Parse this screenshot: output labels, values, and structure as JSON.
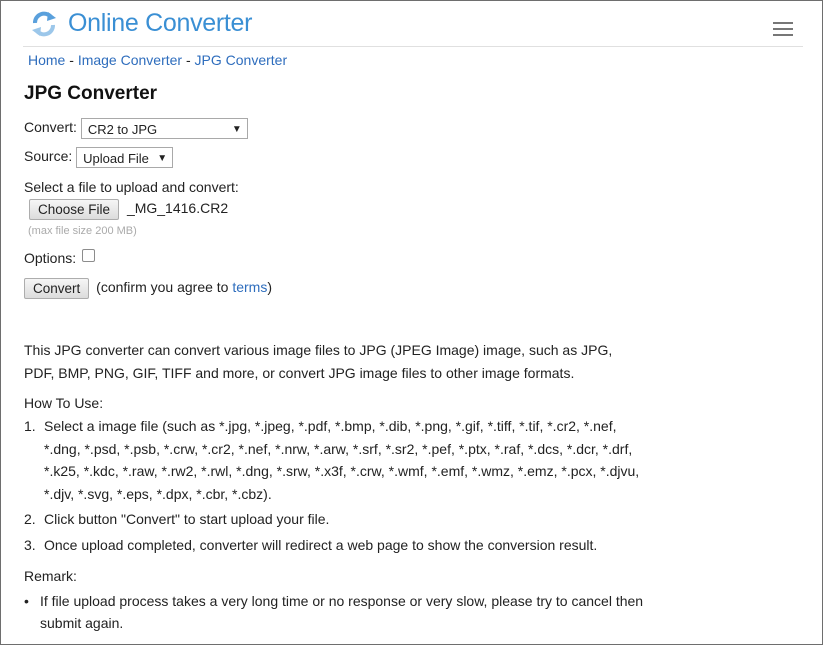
{
  "header": {
    "title": "Online Converter",
    "menu_icon": "hamburger-menu-icon",
    "logo_icon": "refresh-arrows-icon",
    "accent": "#3a8fd4"
  },
  "breadcrumb": {
    "home": "Home",
    "sep1": " - ",
    "image_converter": "Image Converter",
    "sep2": " - ",
    "jpg_converter": "JPG Converter"
  },
  "page_title": "JPG Converter",
  "form": {
    "convert_label": "Convert:",
    "convert_selected": "CR2 to JPG",
    "source_label": "Source:",
    "source_selected": "Upload File",
    "select_file_label": "Select a file to upload and convert:",
    "choose_file_button": "Choose File",
    "file_name": "_MG_1416.CR2",
    "max_size_hint": "(max file size 200 MB)",
    "options_label": "Options:",
    "convert_button": "Convert",
    "confirm_prefix": "(confirm you agree to ",
    "terms_link": "terms",
    "confirm_suffix": ")"
  },
  "description": "This JPG converter can convert various image files to JPG (JPEG Image) image, such as JPG, PDF, BMP, PNG, GIF, TIFF and more, or convert JPG image files to other image formats.",
  "howto": {
    "heading": "How To Use:",
    "steps": [
      {
        "num": "1.",
        "text": "Select a image file (such as *.jpg, *.jpeg, *.pdf, *.bmp, *.dib, *.png, *.gif, *.tiff, *.tif, *.cr2, *.nef, *.dng, *.psd, *.psb, *.crw, *.cr2, *.nef, *.nrw, *.arw, *.srf, *.sr2, *.pef, *.ptx, *.raf, *.dcs, *.dcr, *.drf, *.k25, *.kdc, *.raw, *.rw2, *.rwl, *.dng, *.srw, *.x3f, *.crw, *.wmf, *.emf, *.wmz, *.emz, *.pcx, *.djvu, *.djv, *.svg, *.eps, *.dpx, *.cbr, *.cbz)."
      },
      {
        "num": "2.",
        "text": "Click button \"Convert\" to start upload your file."
      },
      {
        "num": "3.",
        "text": "Once upload completed, converter will redirect a web page to show the conversion result."
      }
    ]
  },
  "remark": {
    "heading": "Remark:",
    "items": [
      {
        "bullet": "•",
        "text": "If file upload process takes a very long time or no response or very slow, please try to cancel then submit again."
      }
    ]
  }
}
